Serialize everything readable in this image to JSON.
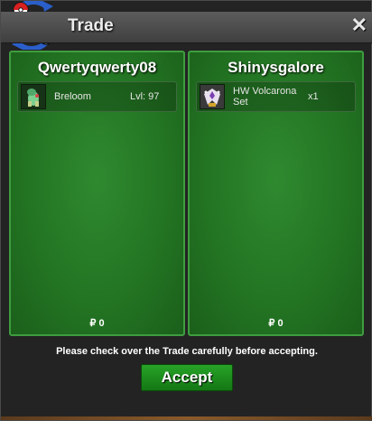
{
  "window": {
    "title": "Trade",
    "close_label": "✕"
  },
  "left_panel": {
    "player_name": "Qwertyqwerty08",
    "item": {
      "name": "Breloom",
      "level": "Lvl: 97",
      "icon": "breloom-sprite"
    },
    "money": "₽ 0"
  },
  "right_panel": {
    "player_name": "Shinysgalore",
    "item": {
      "name": "HW Volcarona Set",
      "quantity": "x1",
      "icon": "volcarona-set-sprite"
    },
    "money": "₽ 0"
  },
  "notice": "Please check over the Trade carefully before accepting.",
  "accept_label": "Accept",
  "colors": {
    "panel_green": "#237523",
    "button_green": "#1f8f1f",
    "title_bar": "#4d4d4d"
  }
}
